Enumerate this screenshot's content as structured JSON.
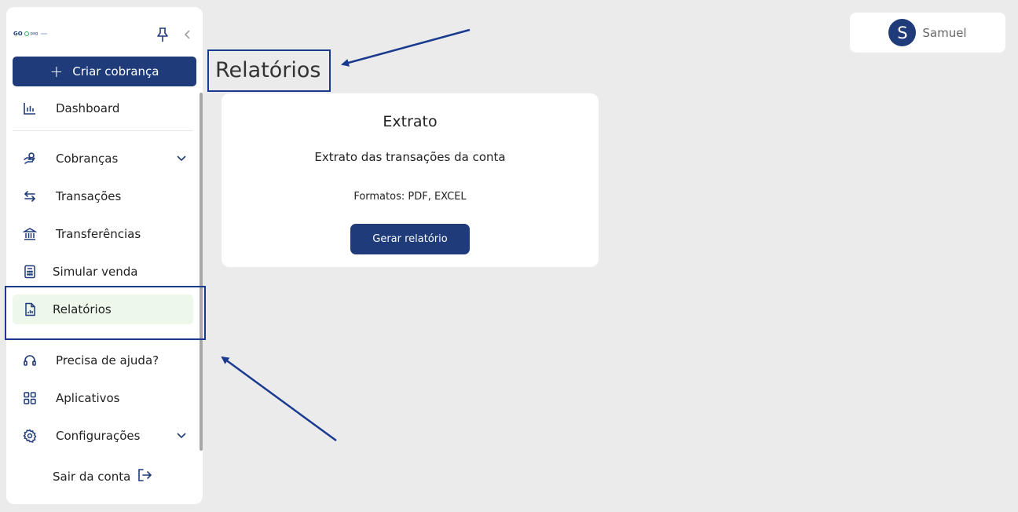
{
  "brand": {
    "logo_go": "GO",
    "logo_pag": "pag"
  },
  "sidebar": {
    "create_label": "Criar cobrança",
    "items": [
      {
        "label": "Dashboard",
        "icon": "chart-bar-icon"
      },
      {
        "label": "Cobranças",
        "icon": "hand-coin-icon",
        "expandable": true
      },
      {
        "label": "Transações",
        "icon": "arrows-swap-icon"
      },
      {
        "label": "Transferências",
        "icon": "bank-icon"
      },
      {
        "label": "Simular venda",
        "icon": "calculator-icon"
      },
      {
        "label": "Relatórios",
        "icon": "report-file-icon",
        "active": true
      },
      {
        "label": "Precisa de ajuda?",
        "icon": "headset-icon"
      },
      {
        "label": "Aplicativos",
        "icon": "apps-grid-icon"
      },
      {
        "label": "Configurações",
        "icon": "gear-icon",
        "expandable": true
      }
    ],
    "logout_label": "Sair da conta"
  },
  "page": {
    "title": "Relatórios"
  },
  "report_card": {
    "title": "Extrato",
    "description": "Extrato das transações da conta",
    "formats": "Formatos: PDF, EXCEL",
    "button_label": "Gerar relatório"
  },
  "user": {
    "initial": "S",
    "name": "Samuel"
  },
  "colors": {
    "primary": "#1f3b7a",
    "active_bg": "#edf8eb",
    "annotation": "#1a3a8f"
  }
}
